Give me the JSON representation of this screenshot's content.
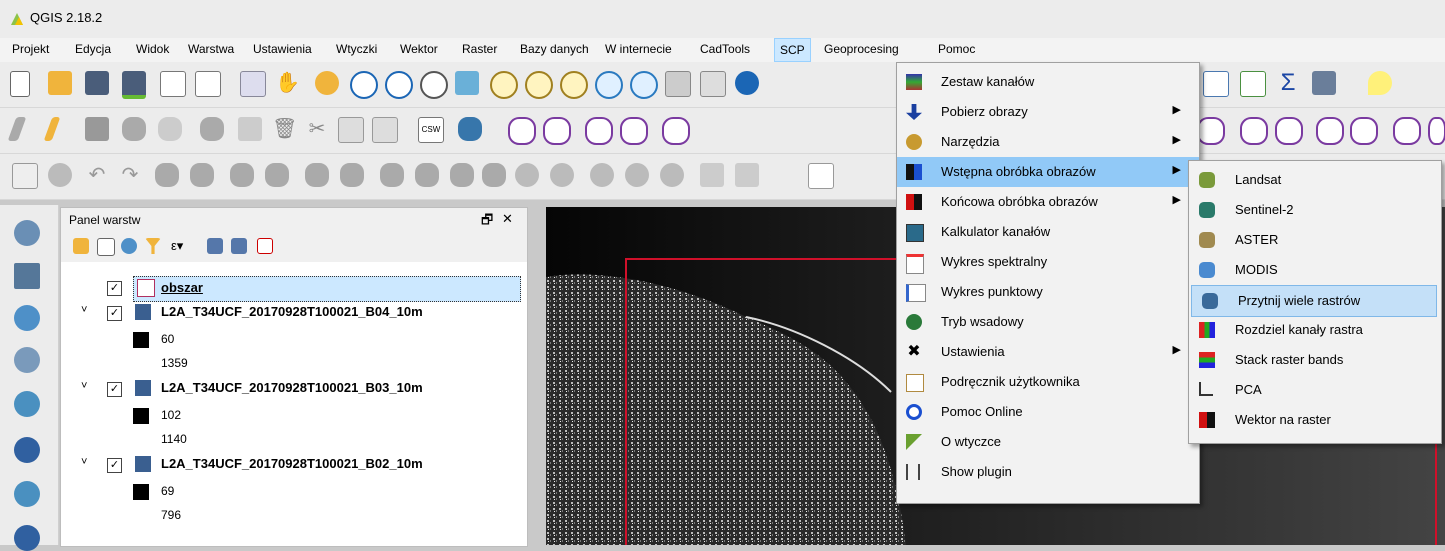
{
  "window": {
    "title": "QGIS 2.18.2"
  },
  "menubar": {
    "items": [
      "Projekt",
      "Edycja",
      "Widok",
      "Warstwa",
      "Ustawienia",
      "Wtyczki",
      "Wektor",
      "Raster",
      "Bazy danych",
      "W internecie",
      "CadTools",
      "SCP",
      "Geoprocesing",
      "Pomoc"
    ],
    "active": "SCP"
  },
  "layers_panel": {
    "title": "Panel warstw",
    "float_symbol": "🗗",
    "close_symbol": "✕",
    "layers": [
      {
        "name": "obszar",
        "checked": true,
        "values": []
      },
      {
        "name": "L2A_T34UCF_20170928T100021_B04_10m",
        "checked": true,
        "values": [
          "60",
          "1359"
        ]
      },
      {
        "name": "L2A_T34UCF_20170928T100021_B03_10m",
        "checked": true,
        "values": [
          "102",
          "1140"
        ]
      },
      {
        "name": "L2A_T34UCF_20170928T100021_B02_10m",
        "checked": true,
        "values": [
          "69",
          "796"
        ]
      }
    ]
  },
  "scp_menu": {
    "items": [
      {
        "label": "Zestaw kanałów",
        "icon": "band-set-icon",
        "submenu": false
      },
      {
        "label": "Pobierz obrazy",
        "icon": "download-icon",
        "submenu": true
      },
      {
        "label": "Narzędzia",
        "icon": "tools-icon",
        "submenu": true
      },
      {
        "label": "Wstępna obróbka obrazów",
        "icon": "preprocessing-icon",
        "submenu": true,
        "highlighted": true
      },
      {
        "label": "Końcowa obróbka obrazów",
        "icon": "postprocessing-icon",
        "submenu": true
      },
      {
        "label": "Kalkulator kanałów",
        "icon": "band-calc-icon",
        "submenu": false
      },
      {
        "label": "Wykres spektralny",
        "icon": "spectral-plot-icon",
        "submenu": false
      },
      {
        "label": "Wykres punktowy",
        "icon": "scatter-plot-icon",
        "submenu": false
      },
      {
        "label": "Tryb wsadowy",
        "icon": "batch-icon",
        "submenu": false
      },
      {
        "label": "Ustawienia",
        "icon": "settings-icon",
        "submenu": true
      },
      {
        "label": "Podręcznik użytkownika",
        "icon": "manual-icon",
        "submenu": false
      },
      {
        "label": "Pomoc Online",
        "icon": "help-online-icon",
        "submenu": false
      },
      {
        "label": "O wtyczce",
        "icon": "about-icon",
        "submenu": false
      },
      {
        "label": "Show plugin",
        "icon": "show-plugin-icon",
        "submenu": false
      }
    ]
  },
  "preprocessing_submenu": {
    "items": [
      {
        "label": "Landsat",
        "icon": "landsat-icon"
      },
      {
        "label": "Sentinel-2",
        "icon": "sentinel-icon"
      },
      {
        "label": "ASTER",
        "icon": "aster-icon"
      },
      {
        "label": "MODIS",
        "icon": "modis-icon"
      },
      {
        "label": "Przytnij wiele rastrów",
        "icon": "clip-rasters-icon",
        "highlighted": true
      },
      {
        "label": "Rozdziel kanały rastra",
        "icon": "split-bands-icon"
      },
      {
        "label": "Stack raster bands",
        "icon": "stack-bands-icon"
      },
      {
        "label": "PCA",
        "icon": "pca-icon"
      },
      {
        "label": "Wektor na raster",
        "icon": "vector-to-raster-icon"
      }
    ]
  },
  "colors": {
    "highlight": "#91c9f7",
    "subhighlight": "#c4e0f8",
    "map_bg": "#050505",
    "boundary": "#d0102a"
  }
}
